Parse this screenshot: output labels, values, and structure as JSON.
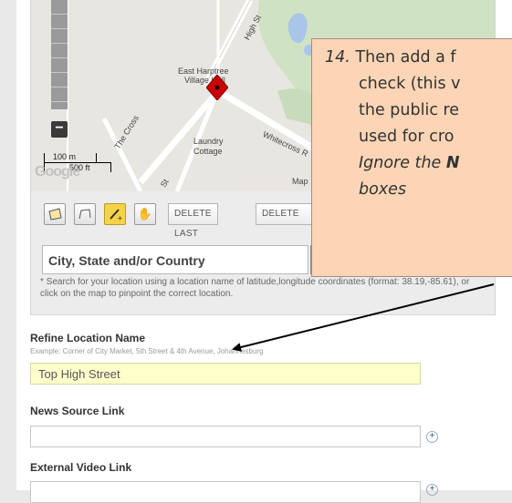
{
  "map": {
    "place_labels": {
      "east_harptree": "East Harptree",
      "village_hall": "Village Hall",
      "laundry": "Laundry",
      "cottage": "Cottage",
      "high_st": "High St",
      "the_cross": "The Cross",
      "whitecross": "Whitecross R",
      "map_label": "Map",
      "st": "St"
    },
    "zoom_out_label": "−",
    "scale_m": "100 m",
    "scale_ft": "500 ft",
    "google_label": "Google"
  },
  "toolbar": {
    "delete_last": "DELETE LAST",
    "delete_all": "DELETE"
  },
  "location": {
    "placeholder": "City, State and/or Country",
    "hint": "* Search for your location using a location name of latitude,longitude coordinates (format: 38.19,-85.61), or click on the map to pinpoint the correct location."
  },
  "fields": {
    "refine_label": "Refine Location Name",
    "refine_example": "Example: Corner of City Market, 5th Street & 4th Avenue, Johannesburg",
    "refine_value": "Top High Street",
    "news_label": "News Source Link",
    "news_value": "",
    "video_label": "External Video Link",
    "video_value": ""
  },
  "callout": {
    "number": "14.",
    "line1": "Then add a f",
    "line2": "check (this v",
    "line3": "the public re",
    "line4": "used for cro",
    "line5a": "Ignore the ",
    "line5b": "N",
    "line6": "boxes"
  },
  "colors": {
    "callout_bg": "#fbd5b5",
    "filled_input_bg": "#ffffcc",
    "marker": "#cc0000",
    "active_tool": "#f4d34a"
  }
}
